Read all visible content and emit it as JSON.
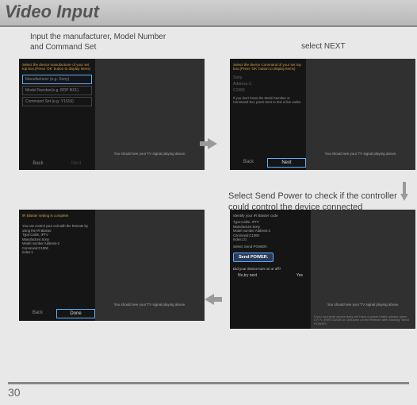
{
  "page": {
    "title": "Video Input",
    "number": "30"
  },
  "captions": {
    "top_left": "Input the manufacturer, Model Number and Command Set",
    "top_right": "select NEXT",
    "mid_right": "Select Send Power to check if the controller could control the device connected"
  },
  "common": {
    "preview": "You should see your TV signal playing above.",
    "back": "Back",
    "next": "Next",
    "done": "Done"
  },
  "screen1": {
    "instr": "Select the device manufacturer of your set top box.(Press 'OK' button to display items)",
    "field1": "Manufacturer (e.g. Sony)",
    "field2": "Model Number(e.g. BDP BX1)",
    "field3": "Command Set (e.g. Y1516)"
  },
  "screen2": {
    "instr": "Select the device Command of your set top box.(Press 'OK' button to display items)",
    "opt1": "Sony",
    "opt2": "Address-2,",
    "opt3": "C1006",
    "note": "If you don't know the Model Number or Command Set, press Next to test a few codes."
  },
  "screen3": {
    "heading": "Identify your IR Blaster code",
    "l1": "Type:Cable, IPTV",
    "l2": "Manufacture:Sony",
    "l3": "Model number:Address-2",
    "l4": "Command:C1006",
    "l5": "Index:1/1",
    "sel": "Select Send POWER.",
    "send": "Send POWER.",
    "q": "Did your device turn on or off?",
    "no": "No,try next",
    "yes": "Yes",
    "tip": "If you connecte device does not have a power button,please press CH +/-,ENR,GUIDE,or Up/Down on the Remote after clicking \"Send POWER\"."
  },
  "screen4": {
    "heading": "IR Blaster setting is complete",
    "body1": "You can control your unit with the Remote by using the IR Blaster.",
    "l1": "Type:Cable, IPTV",
    "l2": "Manufacture:Sony",
    "l3": "Model number:Address-2",
    "l4": "Command:C1006",
    "l5": "Index:1"
  }
}
